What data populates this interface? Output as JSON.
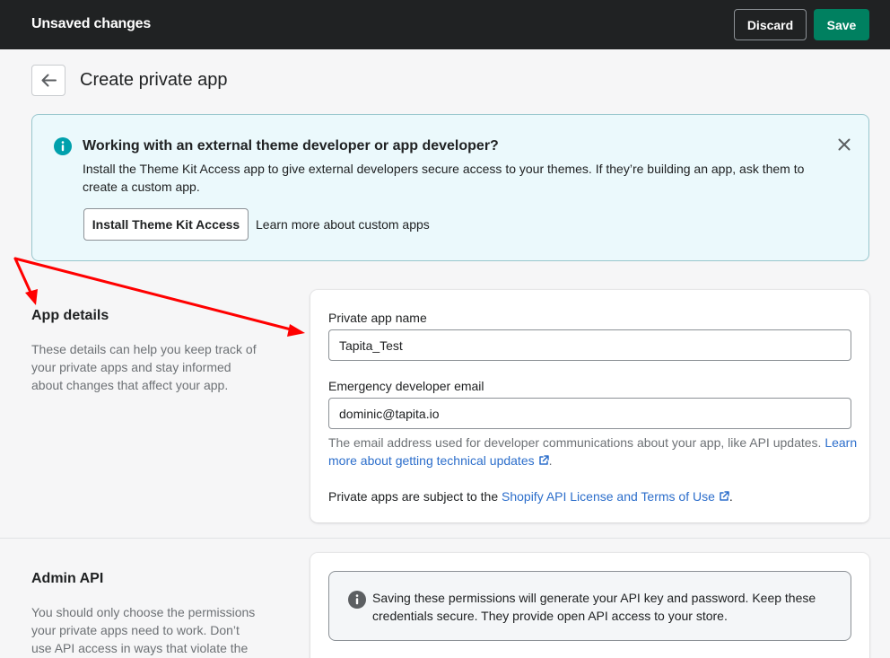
{
  "topbar": {
    "title": "Unsaved changes",
    "discard_label": "Discard",
    "save_label": "Save"
  },
  "page": {
    "title": "Create private app",
    "back_icon": "arrow-left-icon"
  },
  "banner": {
    "title": "Working with an external theme developer or app developer?",
    "body": "Install the Theme Kit Access app to give external developers secure access to your themes. If they’re building an app, ask them to create a custom app.",
    "install_button": "Install Theme Kit Access",
    "learn_link": "Learn more about custom apps",
    "icon": "info-circle-icon",
    "close_icon": "close-icon"
  },
  "app_details": {
    "title": "App details",
    "description": "These details can help you keep track of your private apps and stay informed about changes that affect your app.",
    "name_label": "Private app name",
    "name_value": "Tapita_Test",
    "email_label": "Emergency developer email",
    "email_value": "dominic@tapita.io",
    "email_help_prefix": "The email address used for developer communications about your app, like API updates.",
    "email_help_link": "Learn more about getting technical updates",
    "email_help_suffix": ".",
    "terms_prefix": "Private apps are subject to the",
    "terms_link": "Shopify API License and Terms of Use",
    "terms_suffix": "."
  },
  "admin_api": {
    "title": "Admin API",
    "description": "You should only choose the permissions your private apps need to work. Don’t use API access in ways that violate the",
    "notice": "Saving these permissions will generate your API key and password. Keep these credentials secure. They provide open API access to your store.",
    "notice_icon": "info-circle-icon"
  },
  "colors": {
    "topbar": "#202223",
    "primary": "#008060",
    "banner_bg": "#ebf9fc",
    "link": "#2c6ecb",
    "annotation_arrow": "#ff0000"
  }
}
